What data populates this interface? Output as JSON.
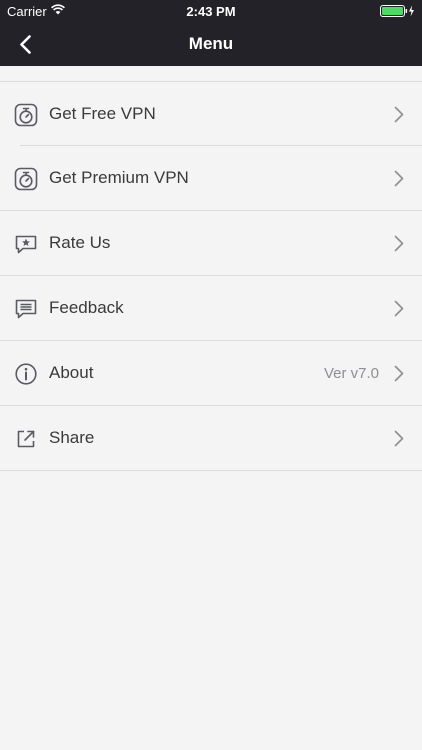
{
  "status_bar": {
    "carrier": "Carrier",
    "time": "2:43 PM",
    "wifi_icon": "wifi-icon",
    "battery_icon": "battery-charging-icon"
  },
  "nav": {
    "title": "Menu",
    "back_icon": "chevron-left-icon"
  },
  "menu": {
    "items": [
      {
        "label": "Get Free VPN",
        "icon": "stopwatch-icon",
        "detail": ""
      },
      {
        "label": "Get Premium VPN",
        "icon": "stopwatch-icon",
        "detail": ""
      },
      {
        "label": "Rate Us",
        "icon": "star-bubble-icon",
        "detail": ""
      },
      {
        "label": "Feedback",
        "icon": "chat-bubble-icon",
        "detail": ""
      },
      {
        "label": "About",
        "icon": "info-icon",
        "detail": "Ver v7.0"
      },
      {
        "label": "Share",
        "icon": "share-icon",
        "detail": ""
      }
    ]
  },
  "colors": {
    "nav_background": "#222228",
    "page_background": "#f4f4f4",
    "battery": "#4cd964",
    "icon": "#5a5a64"
  }
}
